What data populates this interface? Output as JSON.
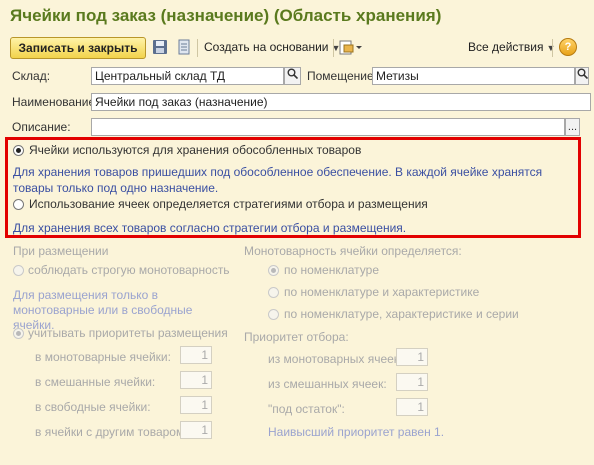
{
  "window": {
    "title": "Ячейки под заказ (назначение) (Область хранения)"
  },
  "toolbar": {
    "save_close_label": "Записать и закрыть",
    "create_based_label": "Создать на основании",
    "all_actions_label": "Все действия",
    "help_label": "?"
  },
  "form": {
    "warehouse_label": "Склад:",
    "warehouse_value": "Центральный склад ТД",
    "room_label": "Помещение:",
    "room_value": "Метизы",
    "name_label": "Наименование:",
    "name_value": "Ячейки под заказ (назначение)",
    "description_label": "Описание:",
    "description_value": "",
    "select_btn": "...",
    "search_icon": "magnifier-icon"
  },
  "usage": {
    "option1_label": "Ячейки используются для хранения обособленных товаров",
    "option1_hint": "Для хранения товаров пришедших под обособленное обеспечение. В каждой ячейке хранятся товары только под одно назначение.",
    "option1_selected": true,
    "option2_label": "Использование ячеек определяется стратегиями отбора и размещения",
    "option2_hint": "Для хранения всех товаров согласно стратегии отбора и размещения.",
    "option2_selected": false
  },
  "placement": {
    "header": "При размещении",
    "strict_label": "соблюдать строгую монотоварность",
    "strict_hint": "Для размещения только в монотоварные или в свободные ячейки.",
    "priorities_label": "учитывать приоритеты размещения",
    "mono_label": "в монотоварные ячейки:",
    "mono_value": "1",
    "mixed_label": "в смешанные ячейки:",
    "mixed_value": "1",
    "free_label": "в свободные ячейки:",
    "free_value": "1",
    "other_label": "в ячейки с другим товаром:",
    "other_value": "1"
  },
  "monotony": {
    "header": "Монотоварность ячейки определяется:",
    "opt1_label": "по номенклатуре",
    "opt2_label": "по номенклатуре и характеристике",
    "opt3_label": "по номенклатуре, характеристике и серии"
  },
  "picking": {
    "header": "Приоритет отбора:",
    "mono_label": "из монотоварных ячеек:",
    "mono_value": "1",
    "mixed_label": "из смешанных ячеек:",
    "mixed_value": "1",
    "remainder_label": "\"под остаток\":",
    "remainder_value": "1",
    "hint": "Наивысший приоритет равен 1."
  },
  "colors": {
    "title": "#5a7a1e",
    "highlight_border": "#e20000",
    "hint_text": "#3a4fa2",
    "background": "#fbf4d9"
  }
}
